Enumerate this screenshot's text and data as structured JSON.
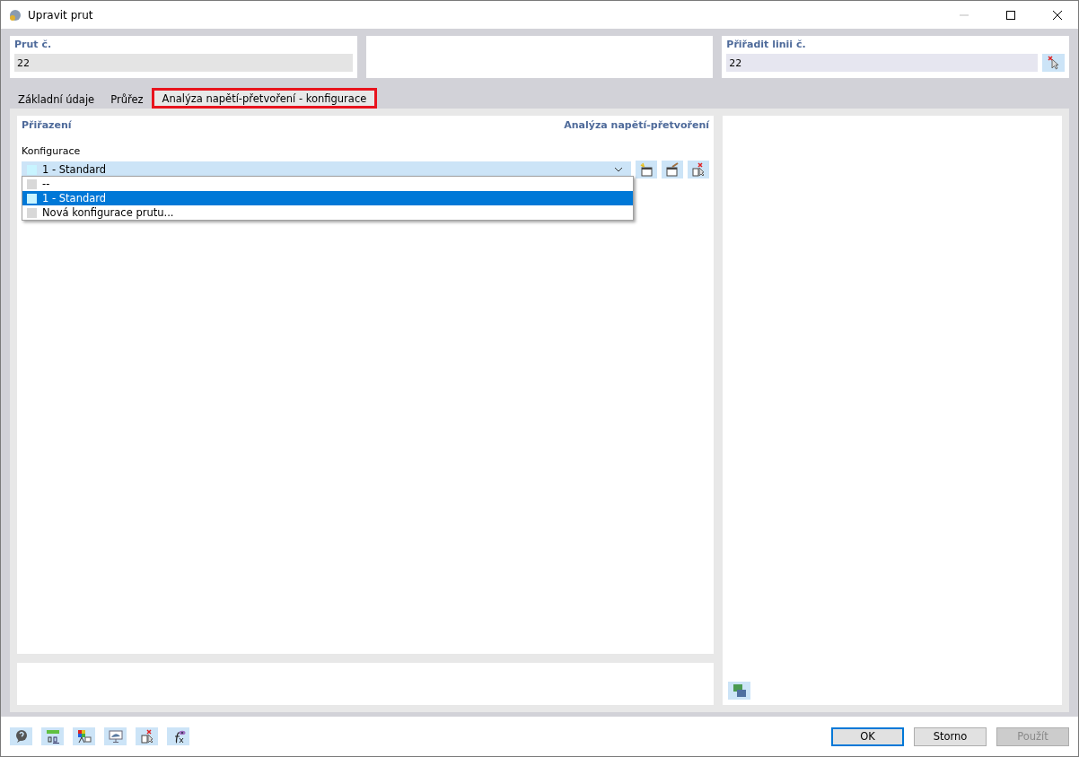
{
  "window": {
    "title": "Upravit prut"
  },
  "header": [
    {
      "label": "Prut č.",
      "value": "22",
      "kind": "readonly"
    },
    {
      "kind": "empty"
    },
    {
      "label": "Přiřadit linii č.",
      "value": "22",
      "kind": "picker"
    }
  ],
  "tabs": [
    {
      "label": "Základní údaje",
      "selected": false,
      "highlighted": false
    },
    {
      "label": "Průřez",
      "selected": false,
      "highlighted": false
    },
    {
      "label": "Analýza napětí-přetvoření - konfigurace",
      "selected": true,
      "highlighted": true
    }
  ],
  "panel": {
    "section_left": "Přiřazení",
    "section_right": "Analýza napětí-přetvoření",
    "field_label": "Konfigurace",
    "combo": {
      "value": "1 - Standard",
      "color": "#c8f4ff",
      "expanded": true
    },
    "options": [
      {
        "label": "--",
        "color": "#d8d8d8",
        "selected": false
      },
      {
        "label": "1 - Standard",
        "color": "#c8f4ff",
        "selected": true
      },
      {
        "label": "Nová konfigurace prutu...",
        "color": "#d8d8d8",
        "selected": false
      }
    ]
  },
  "buttons": [
    {
      "label": "OK",
      "default": true,
      "disabled": false
    },
    {
      "label": "Storno",
      "default": false,
      "disabled": false
    },
    {
      "label": "Použít",
      "default": false,
      "disabled": true
    }
  ]
}
